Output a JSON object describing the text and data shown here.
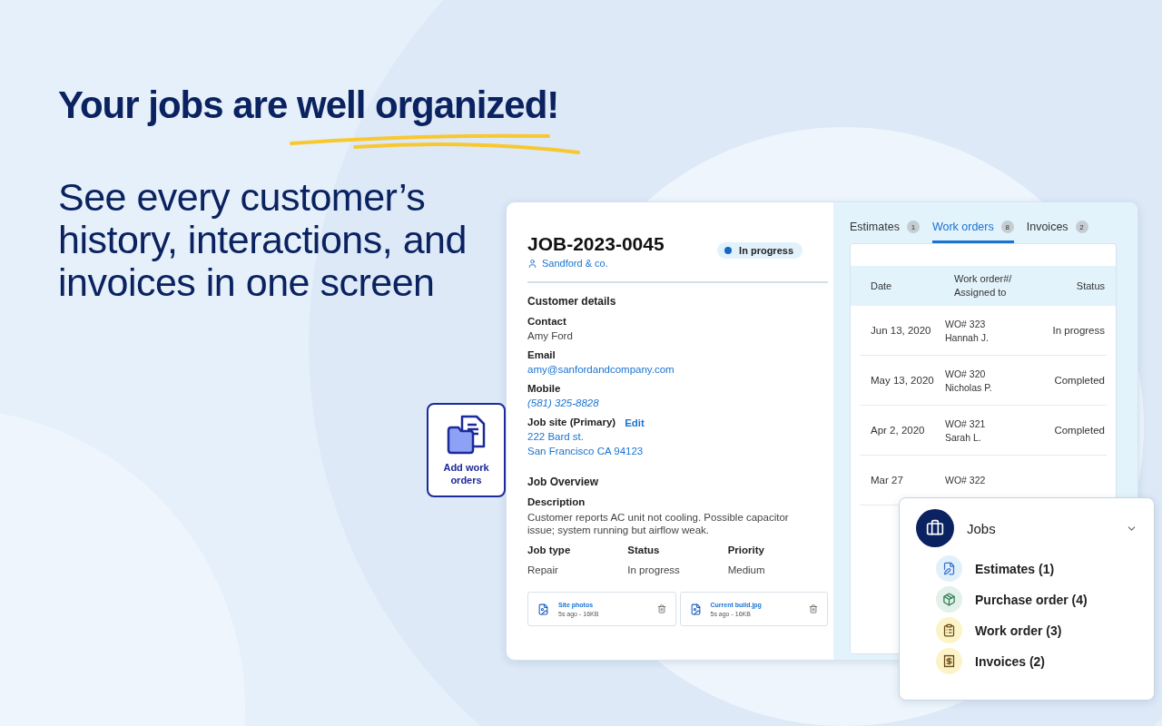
{
  "headline": "Your jobs are well organized!",
  "subheadline_lines": [
    "See every customer’s",
    "history, interactions, and",
    "invoices in one screen"
  ],
  "job": {
    "id": "JOB-2023-0045",
    "client": "Sandford & co.",
    "status": "In progress",
    "customer_section": "Customer details",
    "fields": [
      {
        "label": "Contact",
        "value": "Amy Ford",
        "kind": "plain"
      },
      {
        "label": "Email",
        "value": "amy@sanfordandcompany.com",
        "kind": "link"
      },
      {
        "label": "Mobile",
        "value": "(581) 325-8828",
        "kind": "phone"
      }
    ],
    "site": {
      "label": "Job site (Primary)",
      "action": "Edit",
      "lines": [
        "222 Bard st.",
        "San Francisco CA 94123"
      ]
    },
    "overview_section": "Job Overview",
    "description_label": "Description",
    "description": "Customer reports AC unit not cooling. Possible capacitor issue; system running but airflow weak.",
    "facts": [
      {
        "label": "Job type",
        "value": "Repair"
      },
      {
        "label": "Status",
        "value": "In progress"
      },
      {
        "label": "Priority",
        "value": "Medium"
      }
    ],
    "attachments": [
      {
        "name": "Site photos",
        "meta": "5s ago - 16KB"
      },
      {
        "name": "Current build.jpg",
        "meta": "5s ago - 16KB"
      }
    ]
  },
  "tabs": [
    {
      "label": "Estimates",
      "count": "1",
      "selected": false
    },
    {
      "label": "Work orders",
      "count": "8",
      "selected": true
    },
    {
      "label": "Invoices",
      "count": "2",
      "selected": false
    }
  ],
  "table": {
    "columns": [
      "Date",
      "Work order#/ Assigned to",
      "Status"
    ],
    "rows": [
      {
        "date": "Jun 13, 2020",
        "number": "WO# 323",
        "assignee": "Hannah J.",
        "status": "In progress"
      },
      {
        "date": "May 13, 2020",
        "number": "WO# 320",
        "assignee": "Nicholas P.",
        "status": "Completed"
      },
      {
        "date": "Apr 2, 2020",
        "number": "WO# 321",
        "assignee": "Sarah L.",
        "status": "Completed"
      },
      {
        "date": "Mar 27",
        "number": "WO# 322"
      }
    ]
  },
  "add_card": {
    "label": "Add work orders"
  },
  "menu": {
    "title": "Jobs",
    "expanded": true,
    "items": [
      {
        "label": "Estimates (1)",
        "kind": "estimate",
        "color": "#e0f1fc"
      },
      {
        "label": "Purchase order (4)",
        "kind": "purchase",
        "color": "#e2f1e9"
      },
      {
        "label": "Work order (3)",
        "kind": "work",
        "color": "#fcf4c8"
      },
      {
        "label": "Invoices (2)",
        "kind": "invoice",
        "color": "#fcf4c8"
      }
    ]
  }
}
